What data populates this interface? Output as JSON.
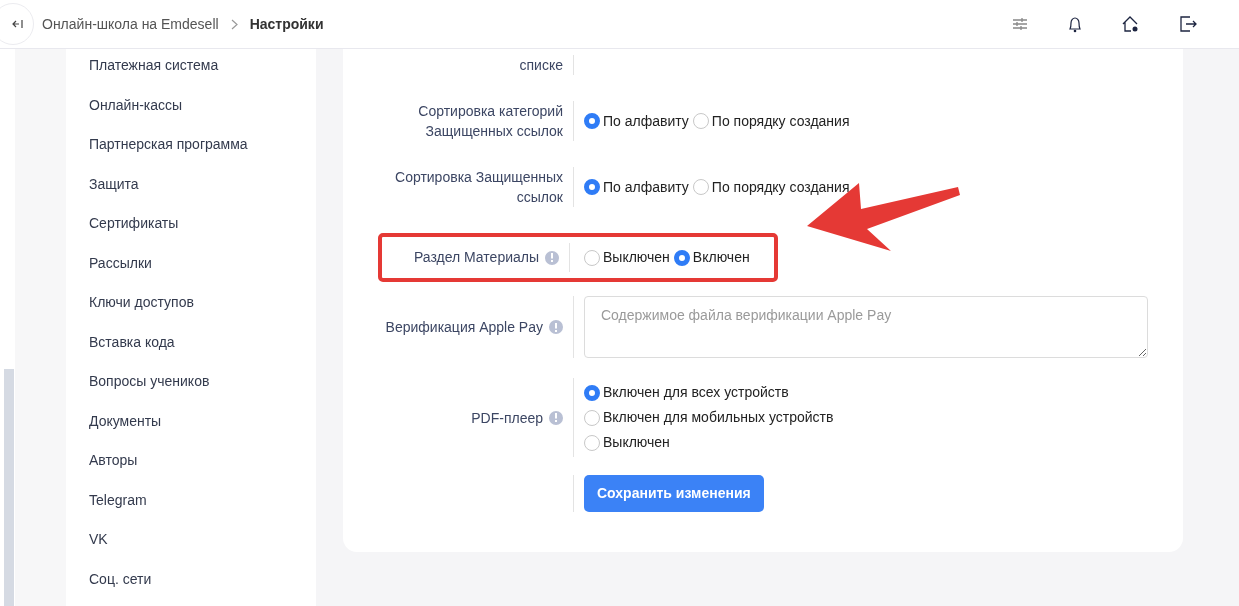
{
  "header": {
    "breadcrumbs": [
      {
        "label": "Онлайн-школа на Emdesell",
        "current": false
      },
      {
        "label": "Настройки",
        "current": true
      }
    ]
  },
  "sidebar": {
    "items": [
      {
        "label": "Платежная система"
      },
      {
        "label": "Онлайн-кассы"
      },
      {
        "label": "Партнерская программа"
      },
      {
        "label": "Защита"
      },
      {
        "label": "Сертификаты"
      },
      {
        "label": "Рассылки"
      },
      {
        "label": "Ключи доступов"
      },
      {
        "label": "Вставка кода"
      },
      {
        "label": "Вопросы учеников"
      },
      {
        "label": "Документы"
      },
      {
        "label": "Авторы"
      },
      {
        "label": "Telegram"
      },
      {
        "label": "VK"
      },
      {
        "label": "Соц. сети"
      }
    ]
  },
  "settings": [
    {
      "kind": "text",
      "label": "списке"
    },
    {
      "kind": "radio-row",
      "label": "Сортировка категорий Защищенных ссылок",
      "options": [
        {
          "label": "По алфавиту",
          "selected": true
        },
        {
          "label": "По порядку создания",
          "selected": false
        }
      ]
    },
    {
      "kind": "radio-row",
      "label": "Сортировка Защищенных ссылок",
      "options": [
        {
          "label": "По алфавиту",
          "selected": true
        },
        {
          "label": "По порядку создания",
          "selected": false
        }
      ]
    },
    {
      "kind": "radio-row",
      "label": "Раздел Материалы",
      "info": true,
      "highlighted": true,
      "options": [
        {
          "label": "Выключен",
          "selected": false
        },
        {
          "label": "Включен",
          "selected": true
        }
      ]
    },
    {
      "kind": "textarea",
      "label": "Верификация Apple Pay",
      "info": true,
      "placeholder": "Содержимое файла верификации Apple Pay"
    },
    {
      "kind": "radio-column",
      "label": "PDF-плеер",
      "info": true,
      "options": [
        {
          "label": "Включен для всех устройств",
          "selected": true
        },
        {
          "label": "Включен для мобильных устройств",
          "selected": false
        },
        {
          "label": "Выключен",
          "selected": false
        }
      ]
    }
  ],
  "save_button": "Сохранить изменения"
}
